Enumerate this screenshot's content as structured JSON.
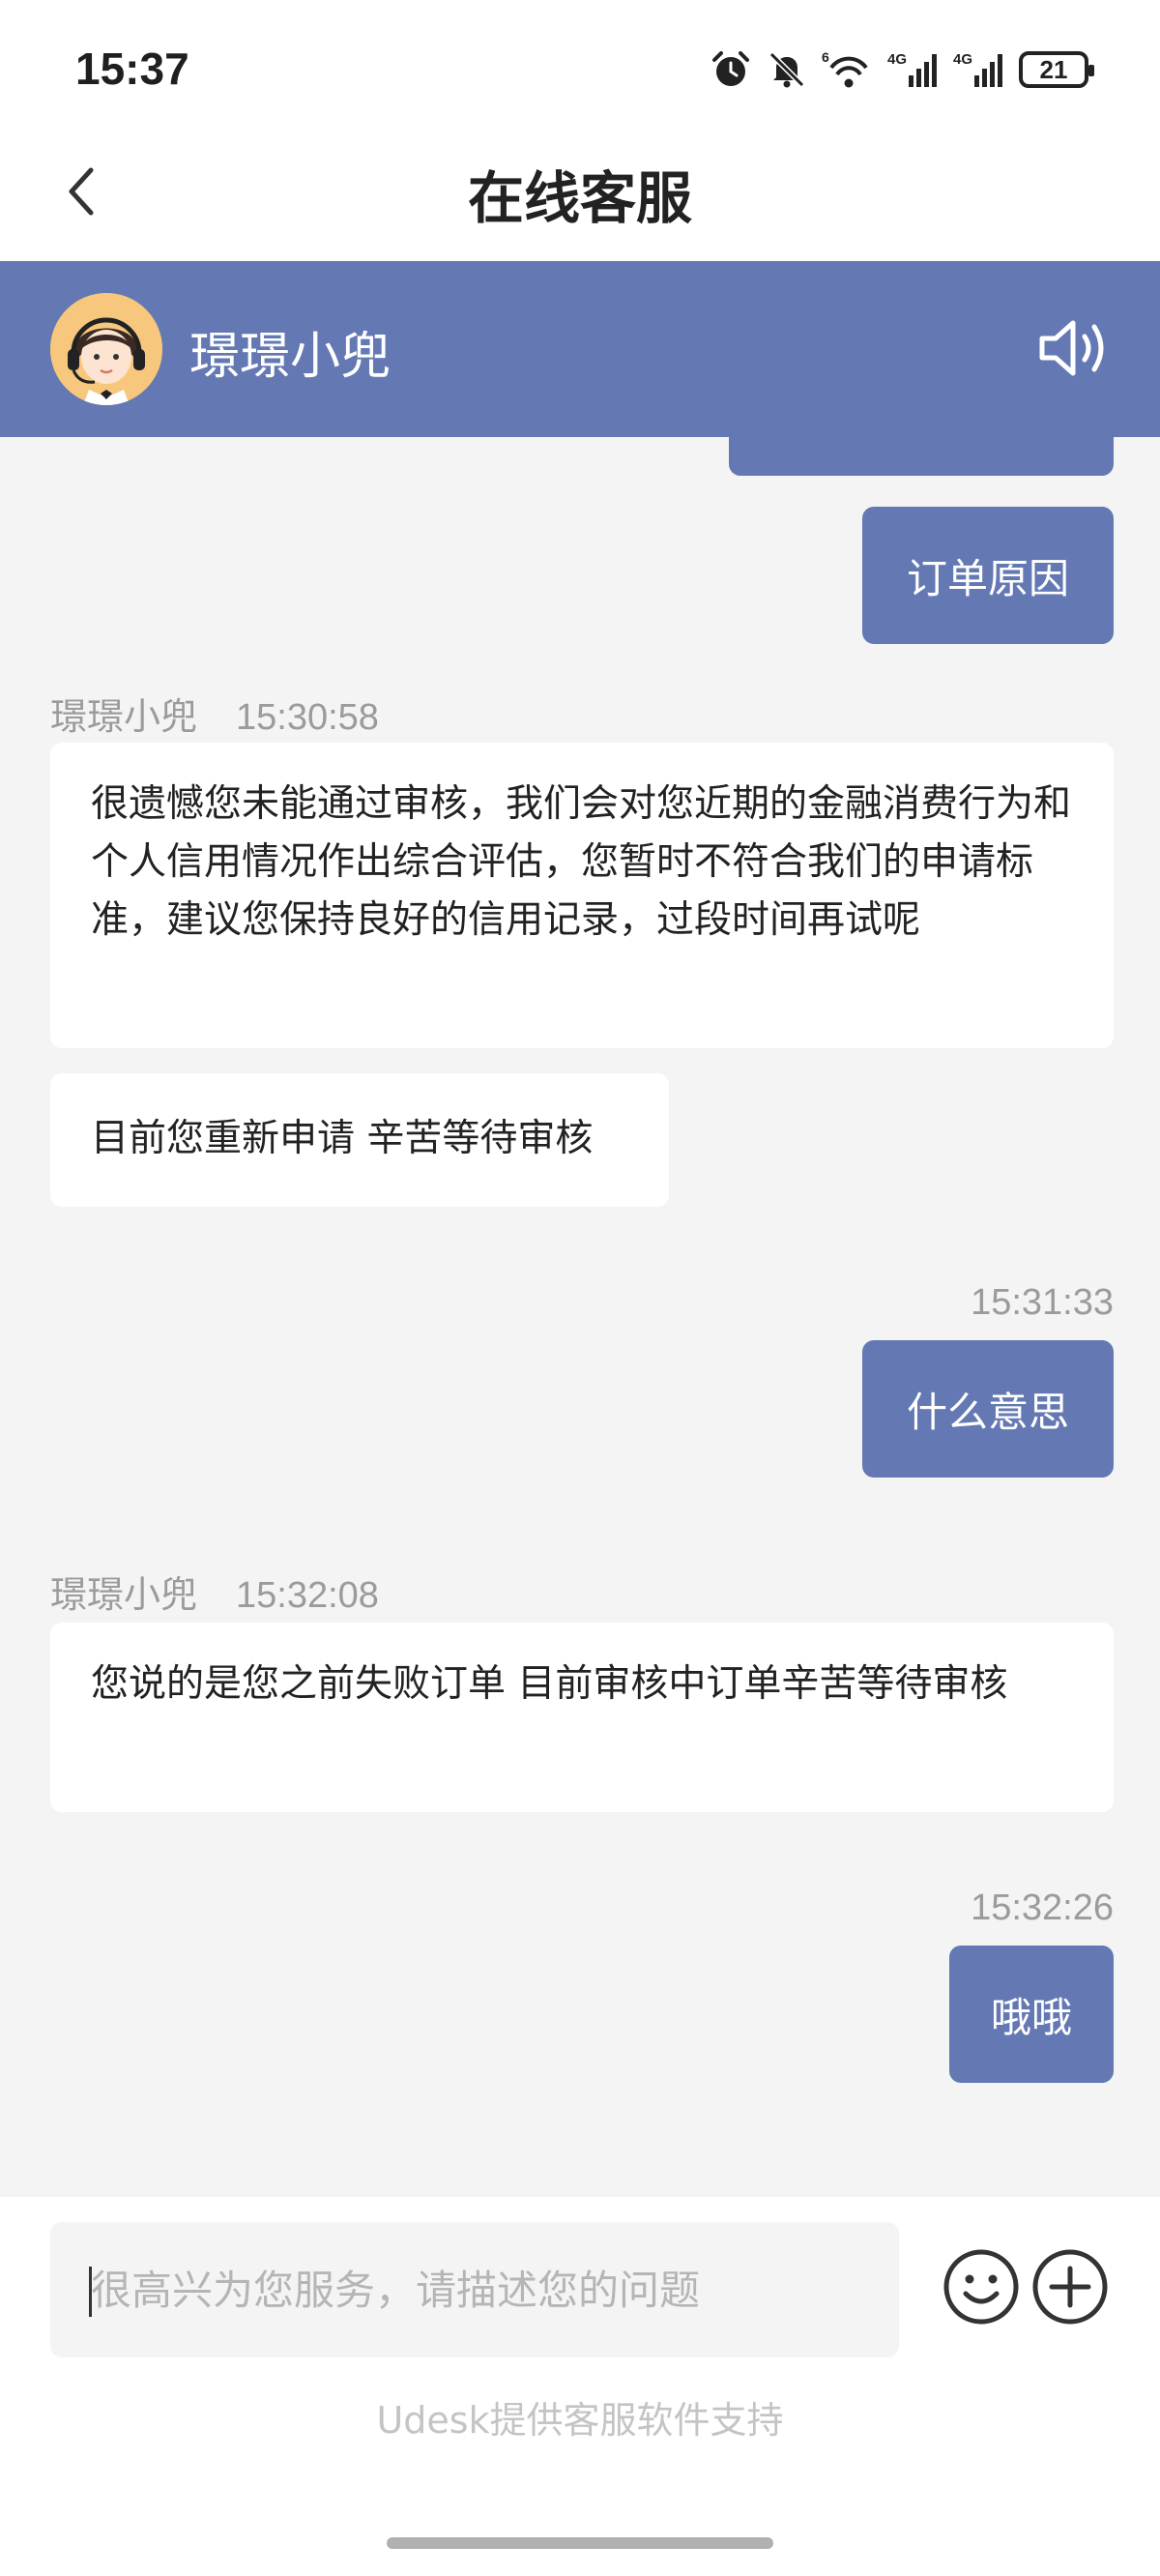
{
  "status_bar": {
    "time": "15:37",
    "battery": "21",
    "icons": [
      "alarm-icon",
      "mute-icon",
      "wifi-icon",
      "signal-4g-icon",
      "signal-4g-icon",
      "battery-icon"
    ],
    "network_labels": [
      "6",
      "4G",
      "4G"
    ]
  },
  "nav": {
    "title": "在线客服",
    "back_icon": "chevron-left-icon"
  },
  "agent": {
    "name": "璟璟小兜",
    "speaker_icon": "speaker-icon"
  },
  "messages": [
    {
      "from": "user",
      "text": ""
    },
    {
      "from": "user",
      "text": "订单原因"
    },
    {
      "from": "agent",
      "sender": "璟璟小兜",
      "time": "15:30:58",
      "text": "很遗憾您未能通过审核，我们会对您近期的金融消费行为和个人信用情况作出综合评估，您暂时不符合我们的申请标准，建议您保持良好的信用记录，过段时间再试呢"
    },
    {
      "from": "agent",
      "text": "目前您重新申请 辛苦等待审核"
    },
    {
      "from": "user",
      "time": "15:31:33",
      "text": "什么意思"
    },
    {
      "from": "agent",
      "sender": "璟璟小兜",
      "time": "15:32:08",
      "text": "您说的是您之前失败订单 目前审核中订单辛苦等待审核"
    },
    {
      "from": "user",
      "time": "15:32:26",
      "text": "哦哦"
    }
  ],
  "input": {
    "placeholder": "很高兴为您服务，请描述您的问题",
    "value": ""
  },
  "footer": {
    "powered_by": "Udesk提供客服软件支持"
  },
  "colors": {
    "accent": "#6479b3",
    "background": "#f4f4f4",
    "bubble_in": "#ffffff",
    "meta_text": "#9b9b9b"
  }
}
